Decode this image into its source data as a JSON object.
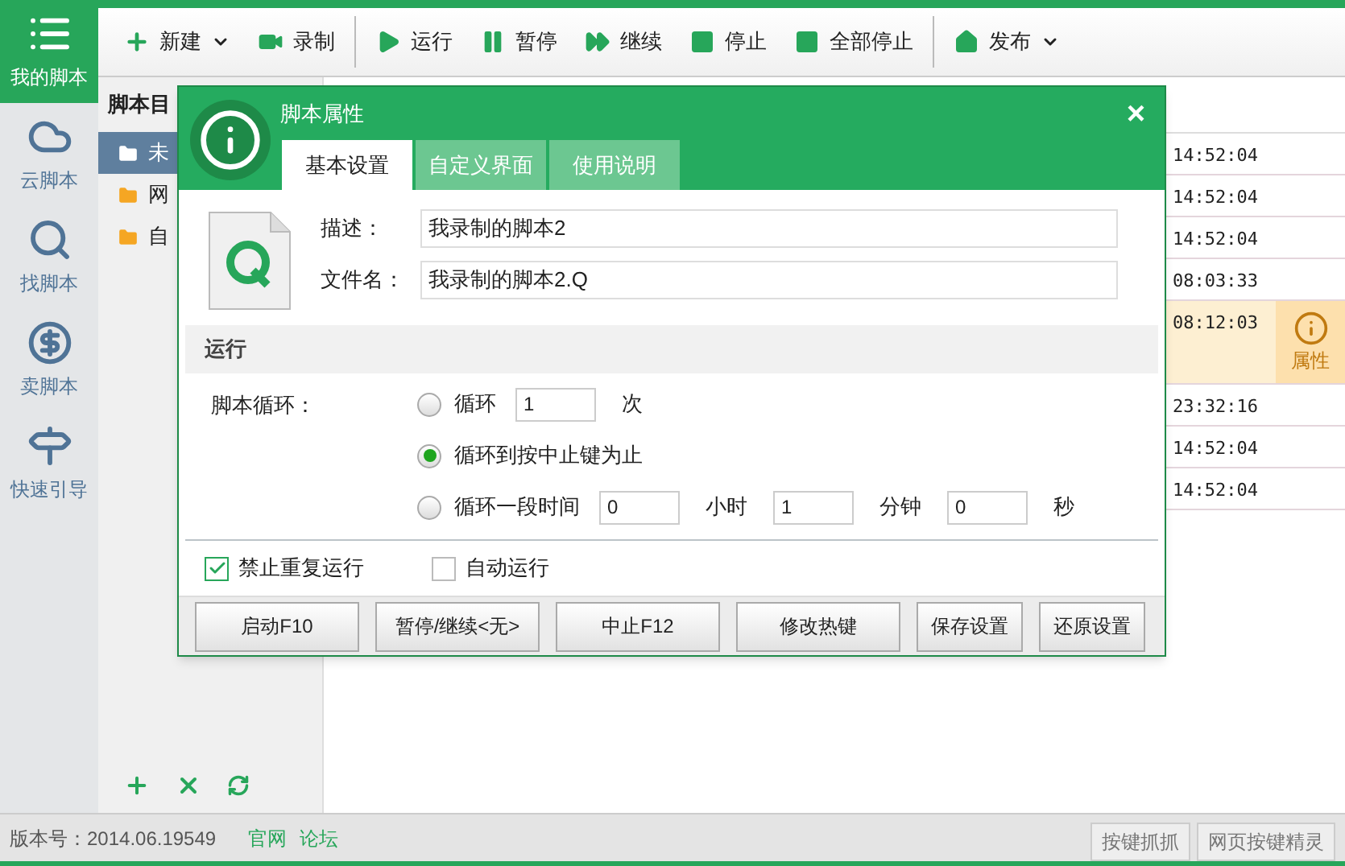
{
  "nav": [
    {
      "label": "我的脚本",
      "selected": true
    },
    {
      "label": "云脚本",
      "selected": false
    },
    {
      "label": "找脚本",
      "selected": false
    },
    {
      "label": "卖脚本",
      "selected": false
    },
    {
      "label": "快速引导",
      "selected": false
    }
  ],
  "toolbar": [
    {
      "label": "新建",
      "dropdown": true,
      "separator_after": false
    },
    {
      "label": "录制",
      "dropdown": false,
      "separator_after": true
    },
    {
      "label": "运行",
      "dropdown": false,
      "separator_after": false
    },
    {
      "label": "暂停",
      "dropdown": false,
      "separator_after": false
    },
    {
      "label": "继续",
      "dropdown": false,
      "separator_after": false
    },
    {
      "label": "停止",
      "dropdown": false,
      "separator_after": false
    },
    {
      "label": "全部停止",
      "dropdown": false,
      "separator_after": true
    },
    {
      "label": "发布",
      "dropdown": true,
      "separator_after": false
    }
  ],
  "directory": {
    "title": "脚本目",
    "items": [
      {
        "label": "未",
        "selected": true
      },
      {
        "label": "网",
        "selected": false
      },
      {
        "label": "自",
        "selected": false
      }
    ]
  },
  "table": {
    "rows": [
      {
        "time": "14:52:04",
        "selected": false
      },
      {
        "time": "14:52:04",
        "selected": false
      },
      {
        "time": "14:52:04",
        "selected": false
      },
      {
        "time": "08:03:33",
        "selected": false
      },
      {
        "time": "08:12:03",
        "selected": true,
        "action": "属性"
      },
      {
        "time": "23:32:16",
        "selected": false
      },
      {
        "time": "14:52:04",
        "selected": false
      },
      {
        "time": "14:52:04",
        "selected": false
      }
    ]
  },
  "dialog": {
    "title": "脚本属性",
    "close": "×",
    "tabs": [
      {
        "label": "基本设置",
        "selected": true
      },
      {
        "label": "自定义界面",
        "selected": false
      },
      {
        "label": "使用说明",
        "selected": false
      }
    ],
    "fields": [
      {
        "label": "描述：",
        "value": "我录制的脚本2"
      },
      {
        "label": "文件名：",
        "value": "我录制的脚本2.Q"
      }
    ],
    "section": "运行",
    "loop_label": "脚本循环：",
    "options": [
      {
        "label": "循环",
        "selected": false,
        "inputs": [
          {
            "value": "1",
            "unit": "次"
          }
        ]
      },
      {
        "label": "循环到按中止键为止",
        "selected": true
      },
      {
        "label": "循环一段时间",
        "selected": false,
        "inputs": [
          {
            "value": "0",
            "unit": "小时"
          },
          {
            "value": "1",
            "unit": "分钟"
          },
          {
            "value": "0",
            "unit": "秒"
          }
        ]
      }
    ],
    "checkboxes": [
      {
        "label": "禁止重复运行",
        "checked": true
      },
      {
        "label": "自动运行",
        "checked": false
      }
    ],
    "buttons": [
      "启动F10",
      "暂停/继续<无>",
      "中止F12",
      "修改热键",
      "保存设置",
      "还原设置"
    ]
  },
  "status_bar": {
    "version": "版本号：2014.06.19549",
    "links": [
      "官网",
      "论坛"
    ],
    "buttons": [
      "按键抓抓",
      "网页按键精灵"
    ]
  }
}
